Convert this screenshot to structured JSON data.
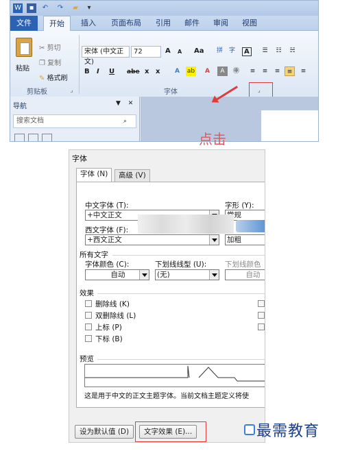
{
  "ribbon": {
    "qat_icons": [
      "word-icon",
      "save-icon",
      "undo-icon",
      "redo-icon",
      "open-icon",
      "customize-icon"
    ],
    "tabs": [
      {
        "label": "文件"
      },
      {
        "label": "开始"
      },
      {
        "label": "插入"
      },
      {
        "label": "页面布局"
      },
      {
        "label": "引用"
      },
      {
        "label": "邮件"
      },
      {
        "label": "审阅"
      },
      {
        "label": "视图"
      }
    ],
    "clipboard": {
      "paste": "粘贴",
      "cut": "剪切",
      "copy": "复制",
      "format_painter": "格式刷",
      "group_label": "剪贴板"
    },
    "font": {
      "font_name": "宋体 (中文正文)",
      "font_size": "72",
      "grow": "A",
      "shrink": "A",
      "case": "Aa",
      "clear": "A",
      "group_label": "字体",
      "bold": "B",
      "italic": "I",
      "underline": "U",
      "strike": "abe",
      "subscript": "x",
      "superscript": "x"
    },
    "accent": "#2b62b3"
  },
  "nav_pane": {
    "title": "导航",
    "search_placeholder": "搜索文档"
  },
  "annotation": {
    "click_text": "点击",
    "color": "#e03a3a"
  },
  "dialog": {
    "title": "字体",
    "tabs": [
      {
        "label": "字体 (N)"
      },
      {
        "label": "高级 (V)"
      }
    ],
    "cn_font_label": "中文字体 (T):",
    "cn_font_value": "+中文正文",
    "style_label": "字形 (Y):",
    "style_value": "常规",
    "west_font_label": "西文字体 (F):",
    "west_font_value": "+西文正文",
    "style_bold": "加粗",
    "all_text_label": "所有文字",
    "font_color_label": "字体颜色 (C):",
    "font_color_value": "自动",
    "underline_style_label": "下划线线型 (U):",
    "underline_style_value": "(无)",
    "underline_color_label": "下划线颜色",
    "underline_color_value": "自动",
    "effects_label": "效果",
    "effects": [
      {
        "label": "删除线 (K)"
      },
      {
        "label": "双删除线 (L)"
      },
      {
        "label": "上标 (P)"
      },
      {
        "label": "下标 (B)"
      }
    ],
    "preview_label": "预览",
    "preview_caption": "这是用于中文的正文主题字体。当前文档主题定义将使",
    "set_default_button": "设为默认值 (D)",
    "text_effects_button": "文字效果 (E)..."
  },
  "watermark": {
    "text": "最需教育"
  }
}
